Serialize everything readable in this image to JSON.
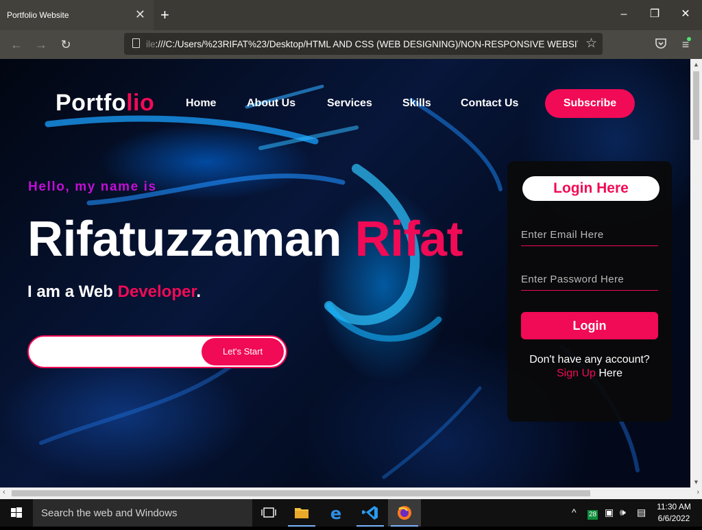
{
  "browser": {
    "tab_title": "Portfolio Website",
    "url_prefix": "ile",
    "url": ":///C:/Users/%23RIFAT%23/Desktop/HTML AND CSS (WEB DESIGNING)/NON-RESPONSIVE WEBSITES",
    "icons": [
      "back-icon",
      "forward-icon",
      "reload-icon",
      "page-icon",
      "star-icon",
      "pocket-icon",
      "menu-icon"
    ]
  },
  "site": {
    "logo_main": "Portfo",
    "logo_accent": "lio",
    "menu": [
      {
        "label": "Home"
      },
      {
        "label": "About Us"
      },
      {
        "label": "Services"
      },
      {
        "label": "Skills"
      },
      {
        "label": "Contact Us"
      }
    ],
    "subscribe_label": "Subscribe",
    "hello": "Hello, my name is",
    "name_first": "Rifatuzzaman ",
    "name_last": "Rifat",
    "role_prefix": "I am a Web ",
    "role_accent": "Developer",
    "role_suffix": ".",
    "start_label": "Let's Start"
  },
  "login": {
    "title": "Login Here",
    "email_placeholder": "Enter Email Here",
    "password_placeholder": "Enter Password Here",
    "button_label": "Login",
    "no_account": "Don't have any account?",
    "signup_label": "Sign Up",
    "signup_suffix": " Here"
  },
  "taskbar": {
    "search_placeholder": "Search the web and Windows",
    "badge_count": "28",
    "time": "11:30 AM",
    "date": "6/6/2022"
  },
  "colors": {
    "accent": "#f10a55",
    "hello": "#c20fd6"
  }
}
